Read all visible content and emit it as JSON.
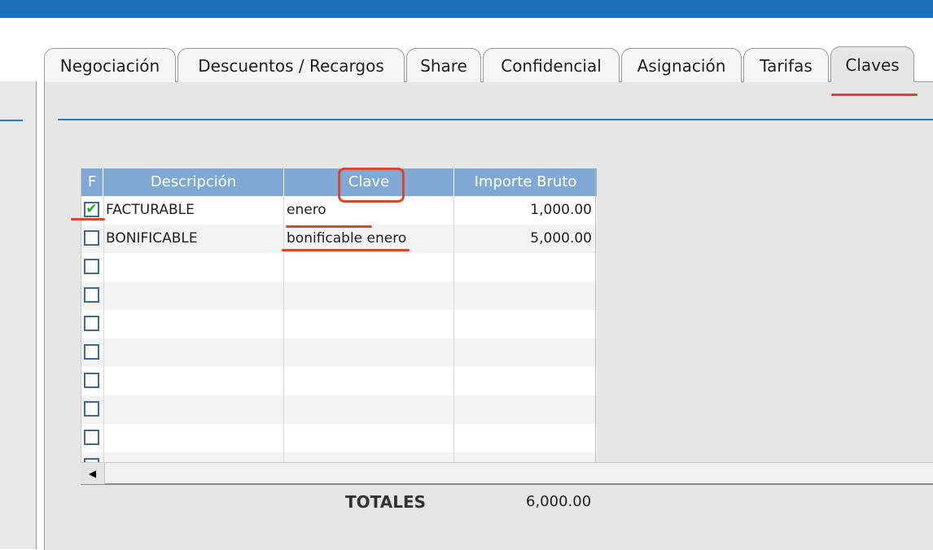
{
  "tabs": [
    {
      "label": "Negociación",
      "active": false
    },
    {
      "label": "Descuentos / Recargos",
      "active": false
    },
    {
      "label": "Share",
      "active": false
    },
    {
      "label": "Confidencial",
      "active": false
    },
    {
      "label": "Asignación",
      "active": false
    },
    {
      "label": "Tarifas",
      "active": false
    },
    {
      "label": "Claves",
      "active": true
    }
  ],
  "grid": {
    "columns": {
      "f": "F",
      "descripcion": "Descripción",
      "clave": "Clave",
      "importe": "Importe Bruto"
    },
    "rows": [
      {
        "checked": true,
        "descripcion": "FACTURABLE",
        "clave": "enero",
        "importe": "1,000.00"
      },
      {
        "checked": false,
        "descripcion": "BONIFICABLE",
        "clave": "bonificable enero",
        "importe": "5,000.00"
      },
      {
        "checked": false,
        "descripcion": "",
        "clave": "",
        "importe": ""
      },
      {
        "checked": false,
        "descripcion": "",
        "clave": "",
        "importe": ""
      },
      {
        "checked": false,
        "descripcion": "",
        "clave": "",
        "importe": ""
      },
      {
        "checked": false,
        "descripcion": "",
        "clave": "",
        "importe": ""
      },
      {
        "checked": false,
        "descripcion": "",
        "clave": "",
        "importe": ""
      },
      {
        "checked": false,
        "descripcion": "",
        "clave": "",
        "importe": ""
      },
      {
        "checked": false,
        "descripcion": "",
        "clave": "",
        "importe": ""
      },
      {
        "checked": false,
        "descripcion": "",
        "clave": "",
        "importe": ""
      }
    ]
  },
  "totals": {
    "label": "TOTALES",
    "value": "6,000.00"
  },
  "colors": {
    "topbar": "#1e71b8",
    "header": "#7fa9d4",
    "annotation": "#d9482b",
    "check": "#28a82a"
  },
  "icons": {
    "scroll_left": "triangle-left-icon",
    "check": "checkmark-icon"
  }
}
